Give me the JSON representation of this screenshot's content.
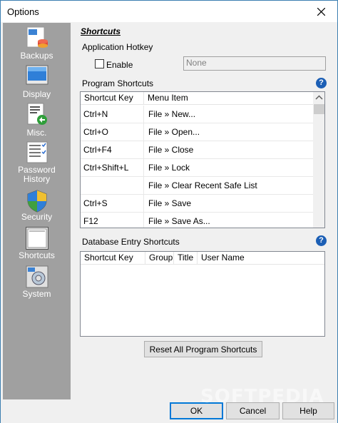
{
  "window": {
    "title": "Options"
  },
  "sidebar": {
    "items": [
      {
        "label": "Backups",
        "icon": "backups-icon"
      },
      {
        "label": "Display",
        "icon": "display-icon"
      },
      {
        "label": "Misc.",
        "icon": "misc-icon"
      },
      {
        "label_line1": "Password",
        "label_line2": "History",
        "icon": "password-history-icon"
      },
      {
        "label": "Security",
        "icon": "security-shield-icon"
      },
      {
        "label": "Shortcuts",
        "icon": "shortcuts-icon",
        "selected": true
      },
      {
        "label": "System",
        "icon": "system-icon"
      }
    ]
  },
  "shortcuts": {
    "section_title": "Shortcuts",
    "app_hotkey": {
      "label": "Application Hotkey",
      "enable_label": "Enable",
      "enabled": false,
      "hotkey_value": "None"
    },
    "program_shortcuts": {
      "label": "Program Shortcuts",
      "columns": [
        "Shortcut Key",
        "Menu Item"
      ],
      "rows": [
        [
          "Ctrl+N",
          "File » New..."
        ],
        [
          "Ctrl+O",
          "File » Open..."
        ],
        [
          "Ctrl+F4",
          "File » Close"
        ],
        [
          "Ctrl+Shift+L",
          "File » Lock"
        ],
        [
          "",
          "File » Clear Recent Safe List"
        ],
        [
          "Ctrl+S",
          "File » Save"
        ],
        [
          "F12",
          "File » Save As..."
        ]
      ]
    },
    "db_entry_shortcuts": {
      "label": "Database Entry Shortcuts",
      "columns": [
        "Shortcut Key",
        "Group",
        "Title",
        "User Name"
      ]
    },
    "reset_button": "Reset All Program Shortcuts"
  },
  "footer": {
    "ok": "OK",
    "cancel": "Cancel",
    "help": "Help"
  },
  "watermark": "SOFTPEDIA",
  "colors": {
    "sidebar_bg": "#a0a0a0",
    "accent": "#0078d7",
    "help_icon": "#1c5fb5"
  }
}
